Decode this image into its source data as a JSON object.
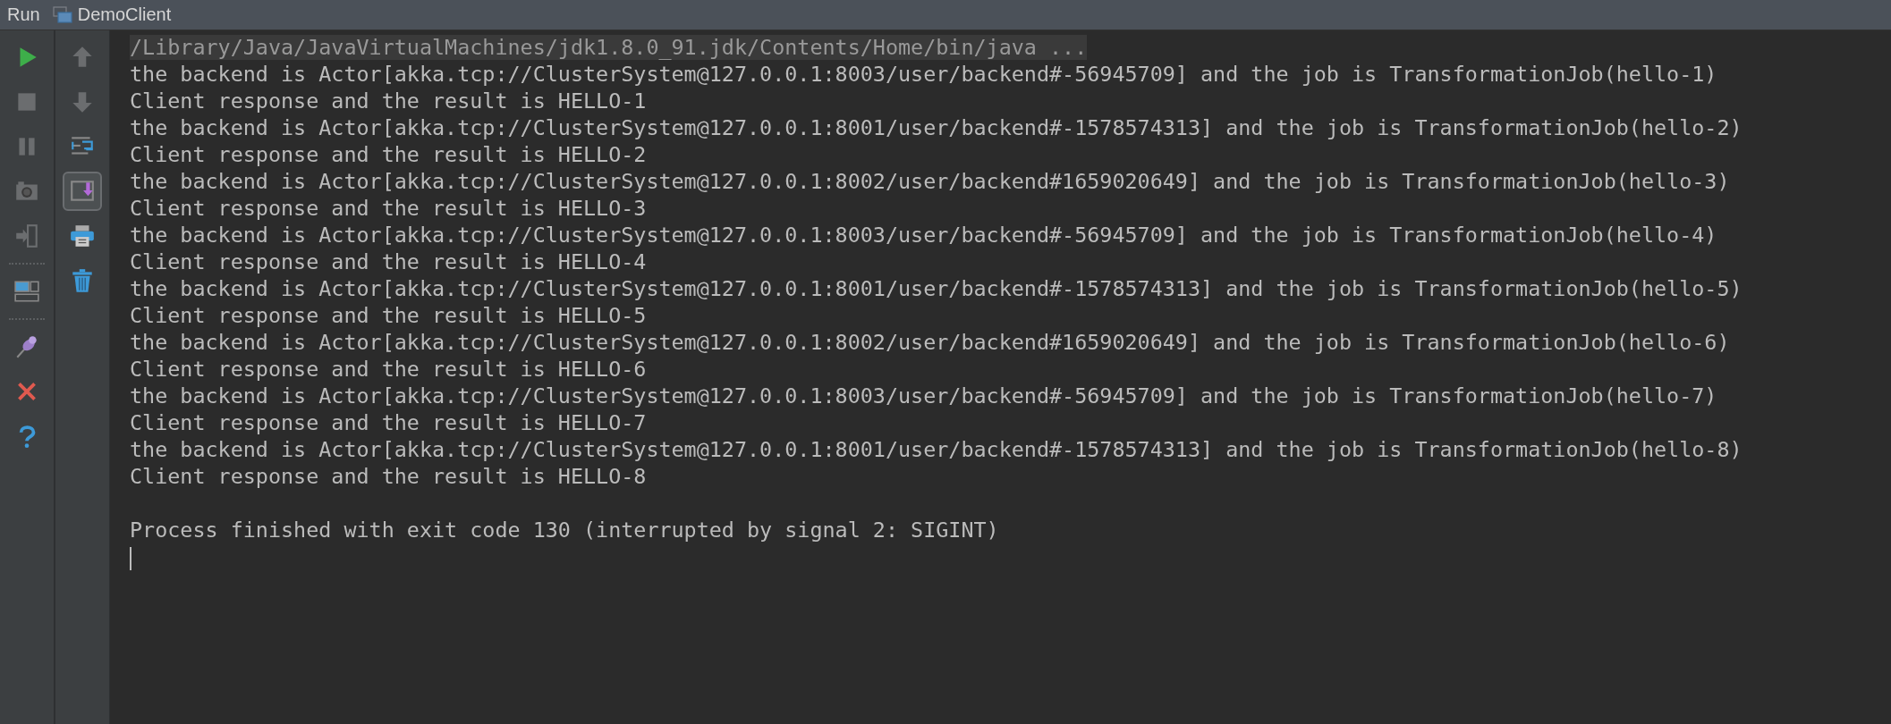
{
  "title_bar": {
    "tool": "Run",
    "configuration": "DemoClient"
  },
  "left_toolbar": [
    {
      "kind": "run"
    },
    {
      "kind": "stop"
    },
    {
      "kind": "pause"
    },
    {
      "kind": "camera"
    },
    {
      "kind": "exit"
    },
    {
      "kind": "separator"
    },
    {
      "kind": "layout"
    },
    {
      "kind": "separator"
    },
    {
      "kind": "pin"
    },
    {
      "kind": "close"
    },
    {
      "kind": "help"
    }
  ],
  "right_toolbar": [
    {
      "kind": "up",
      "selected": false
    },
    {
      "kind": "down",
      "selected": false
    },
    {
      "kind": "wrap",
      "selected": false
    },
    {
      "kind": "scroll_end",
      "selected": true
    },
    {
      "kind": "print",
      "selected": false
    },
    {
      "kind": "trash",
      "selected": false
    }
  ],
  "console": {
    "lines": [
      {
        "kind": "command",
        "text": "/Library/Java/JavaVirtualMachines/jdk1.8.0_91.jdk/Contents/Home/bin/java ..."
      },
      {
        "kind": "output",
        "text": "the backend is Actor[akka.tcp://ClusterSystem@127.0.0.1:8003/user/backend#-56945709] and the job is TransformationJob(hello-1)"
      },
      {
        "kind": "output",
        "text": "Client response and the result is HELLO-1"
      },
      {
        "kind": "output",
        "text": "the backend is Actor[akka.tcp://ClusterSystem@127.0.0.1:8001/user/backend#-1578574313] and the job is TransformationJob(hello-2)"
      },
      {
        "kind": "output",
        "text": "Client response and the result is HELLO-2"
      },
      {
        "kind": "output",
        "text": "the backend is Actor[akka.tcp://ClusterSystem@127.0.0.1:8002/user/backend#1659020649] and the job is TransformationJob(hello-3)"
      },
      {
        "kind": "output",
        "text": "Client response and the result is HELLO-3"
      },
      {
        "kind": "output",
        "text": "the backend is Actor[akka.tcp://ClusterSystem@127.0.0.1:8003/user/backend#-56945709] and the job is TransformationJob(hello-4)"
      },
      {
        "kind": "output",
        "text": "Client response and the result is HELLO-4"
      },
      {
        "kind": "output",
        "text": "the backend is Actor[akka.tcp://ClusterSystem@127.0.0.1:8001/user/backend#-1578574313] and the job is TransformationJob(hello-5)"
      },
      {
        "kind": "output",
        "text": "Client response and the result is HELLO-5"
      },
      {
        "kind": "output",
        "text": "the backend is Actor[akka.tcp://ClusterSystem@127.0.0.1:8002/user/backend#1659020649] and the job is TransformationJob(hello-6)"
      },
      {
        "kind": "output",
        "text": "Client response and the result is HELLO-6"
      },
      {
        "kind": "output",
        "text": "the backend is Actor[akka.tcp://ClusterSystem@127.0.0.1:8003/user/backend#-56945709] and the job is TransformationJob(hello-7)"
      },
      {
        "kind": "output",
        "text": "Client response and the result is HELLO-7"
      },
      {
        "kind": "output",
        "text": "the backend is Actor[akka.tcp://ClusterSystem@127.0.0.1:8001/user/backend#-1578574313] and the job is TransformationJob(hello-8)"
      },
      {
        "kind": "output",
        "text": "Client response and the result is HELLO-8"
      },
      {
        "kind": "blank"
      },
      {
        "kind": "output",
        "text": "Process finished with exit code 130 (interrupted by signal 2: SIGINT)"
      }
    ],
    "input_caret": true
  }
}
